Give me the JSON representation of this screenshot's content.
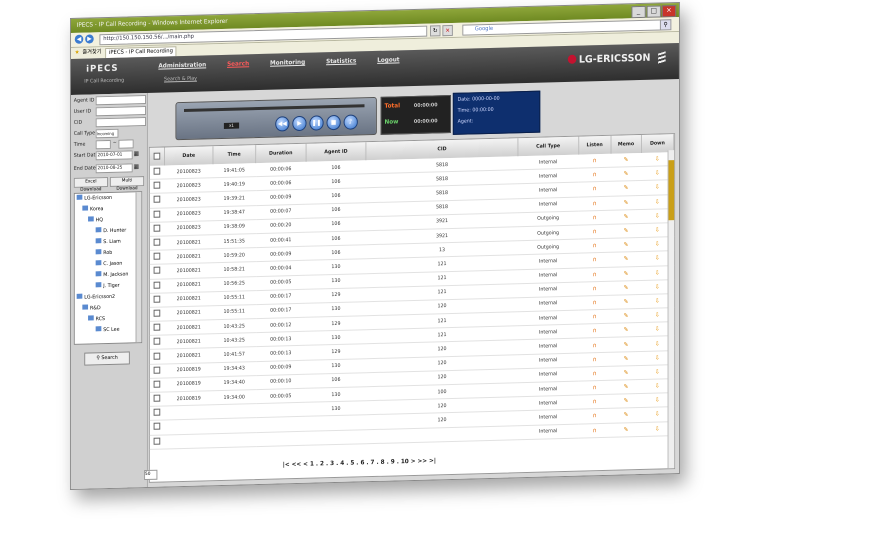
{
  "window": {
    "title": "IPECS - IP Call Recording - Windows Internet Explorer",
    "url": "http://150.150.150.56/.../main.php",
    "search_placeholder": "Google",
    "favorites_label": "즐겨찾기",
    "tab_label": "iPECS - IP Call Recording"
  },
  "header": {
    "logo": "iPECS",
    "logo_sub": "IP Call Recording",
    "menu": [
      "Administration",
      "Search",
      "Monitoring",
      "Statistics",
      "Logout"
    ],
    "submenu": "Search & Play",
    "brand": "LG-ERICSSON"
  },
  "filters": {
    "agent_id_label": "Agent ID",
    "user_id_label": "User ID",
    "cid_label": "CID",
    "call_type_label": "Call Type",
    "call_type_value": "Incoming",
    "time_label": "Time",
    "time_sep": "~",
    "start_date_label": "Start Date",
    "start_date": "2010-07-01",
    "end_date_label": "End Date",
    "end_date": "2010-08-25",
    "excel_download": "Excel Download",
    "multi_download": "Multi Download",
    "search_button": "Search"
  },
  "tree": [
    "LG-Ericsson",
    "Korea",
    "HQ",
    "D. Hunter",
    "S. Liam",
    "Rob",
    "C. Jason",
    "M. Jackson",
    "J. Tiger",
    "LG-Ericsson2",
    "R&D",
    "RCS",
    "SC Lee"
  ],
  "player": {
    "zoom": "x1",
    "total_label": "Total",
    "total_value": "00:00:00",
    "now_label": "Now",
    "now_value": "00:00:00",
    "info_date_label": "Date:",
    "info_date_value": "0000-00-00",
    "info_time_label": "Time:",
    "info_time_value": "00:00:00",
    "info_agent_label": "Agent:"
  },
  "table": {
    "headers": [
      "Date",
      "Time",
      "Duration",
      "Agent ID",
      "CID",
      "Call Type",
      "Listen",
      "Memo",
      "Down"
    ],
    "rows": [
      [
        "20100823",
        "19:41:05",
        "00:00:06",
        "106",
        "5818",
        "Internal"
      ],
      [
        "20100823",
        "19:40:19",
        "00:00:06",
        "106",
        "5818",
        "Internal"
      ],
      [
        "20100823",
        "19:39:21",
        "00:00:09",
        "106",
        "5818",
        "Internal"
      ],
      [
        "20100823",
        "19:38:47",
        "00:00:07",
        "106",
        "5818",
        "Internal"
      ],
      [
        "20100823",
        "19:38:09",
        "00:00:20",
        "106",
        "3921",
        "Outgoing"
      ],
      [
        "20100821",
        "15:51:35",
        "00:00:41",
        "106",
        "3921",
        "Outgoing"
      ],
      [
        "20100821",
        "10:59:20",
        "00:00:09",
        "106",
        "13",
        "Outgoing"
      ],
      [
        "20100821",
        "10:58:21",
        "00:00:04",
        "130",
        "121",
        "Internal"
      ],
      [
        "20100821",
        "10:56:25",
        "00:00:05",
        "130",
        "121",
        "Internal"
      ],
      [
        "20100821",
        "10:55:11",
        "00:00:17",
        "129",
        "121",
        "Internal"
      ],
      [
        "20100821",
        "10:55:11",
        "00:00:17",
        "130",
        "120",
        "Internal"
      ],
      [
        "20100821",
        "10:43:25",
        "00:00:12",
        "129",
        "121",
        "Internal"
      ],
      [
        "20100821",
        "10:43:25",
        "00:00:13",
        "130",
        "121",
        "Internal"
      ],
      [
        "20100821",
        "10:41:57",
        "00:00:13",
        "129",
        "120",
        "Internal"
      ],
      [
        "20100819",
        "19:34:43",
        "00:00:09",
        "130",
        "120",
        "Internal"
      ],
      [
        "20100819",
        "19:34:40",
        "00:00:10",
        "106",
        "120",
        "Internal"
      ],
      [
        "20100819",
        "19:34:00",
        "00:00:05",
        "130",
        "100",
        "Internal"
      ],
      [
        "",
        "",
        "",
        "130",
        "120",
        "Internal"
      ],
      [
        "",
        "",
        "",
        "",
        "120",
        "Internal"
      ],
      [
        "",
        "",
        "",
        "",
        "",
        "Internal"
      ]
    ]
  },
  "pager": {
    "text": "|< << < 1 . 2 . 3 . 4 . 5 . 6 . 7 . 8 . 9 . 10 > >> >|",
    "per_page": "50"
  }
}
